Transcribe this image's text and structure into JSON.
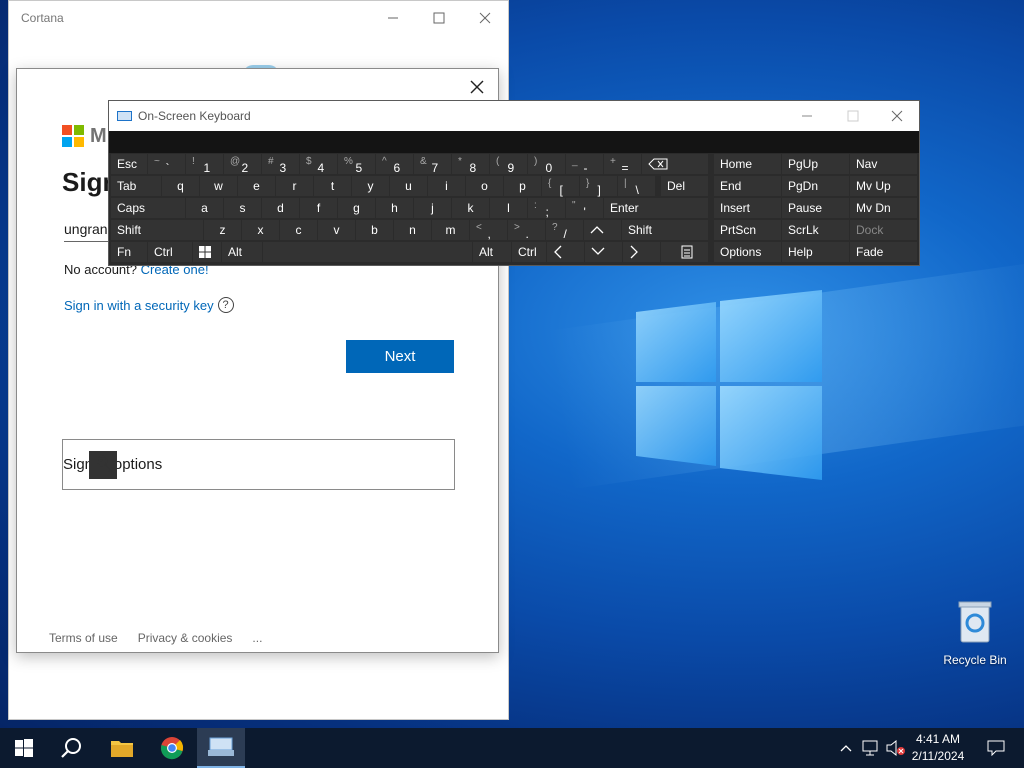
{
  "cortana": {
    "title": "Cortana"
  },
  "signin": {
    "brand": "M",
    "heading": "Sign",
    "email_value": "ungran",
    "no_account_text": "No account?",
    "create_link": "Create one!",
    "security_key_link": "Sign in with a security key",
    "help_glyph": "?",
    "next_label": "Next",
    "options_label": "Sign-in options",
    "footer": {
      "terms": "Terms of use",
      "privacy": "Privacy & cookies",
      "more": "..."
    }
  },
  "osk": {
    "title": "On-Screen Keyboard",
    "keys": {
      "esc": "Esc",
      "tab": "Tab",
      "caps": "Caps",
      "shift": "Shift",
      "fn": "Fn",
      "ctrl": "Ctrl",
      "alt": "Alt",
      "del": "Del",
      "enter": "Enter",
      "home": "Home",
      "pgup": "PgUp",
      "nav": "Nav",
      "end": "End",
      "pgdn": "PgDn",
      "mvup": "Mv Up",
      "insert": "Insert",
      "pause": "Pause",
      "mvdn": "Mv Dn",
      "prtscn": "PrtScn",
      "scrlk": "ScrLk",
      "dock": "Dock",
      "options": "Options",
      "help": "Help",
      "fade": "Fade"
    },
    "number_row": [
      {
        "s": "~",
        "m": "`"
      },
      {
        "s": "!",
        "m": "1"
      },
      {
        "s": "@",
        "m": "2"
      },
      {
        "s": "#",
        "m": "3"
      },
      {
        "s": "$",
        "m": "4"
      },
      {
        "s": "%",
        "m": "5"
      },
      {
        "s": "^",
        "m": "6"
      },
      {
        "s": "&",
        "m": "7"
      },
      {
        "s": "*",
        "m": "8"
      },
      {
        "s": "(",
        "m": "9"
      },
      {
        "s": ")",
        "m": "0"
      },
      {
        "s": "_",
        "m": "-"
      },
      {
        "s": "+",
        "m": "="
      }
    ],
    "row_q": [
      "q",
      "w",
      "e",
      "r",
      "t",
      "y",
      "u",
      "i",
      "o",
      "p"
    ],
    "row_q_sym": [
      {
        "s": "{",
        "m": "["
      },
      {
        "s": "}",
        "m": "]"
      },
      {
        "s": "|",
        "m": "\\"
      }
    ],
    "row_a": [
      "a",
      "s",
      "d",
      "f",
      "g",
      "h",
      "j",
      "k",
      "l"
    ],
    "row_a_sym": [
      {
        "s": ":",
        "m": ";"
      },
      {
        "s": "\"",
        "m": "'"
      }
    ],
    "row_z": [
      "z",
      "x",
      "c",
      "v",
      "b",
      "n",
      "m"
    ],
    "row_z_sym": [
      {
        "s": "<",
        "m": ","
      },
      {
        "s": ">",
        "m": "."
      },
      {
        "s": "?",
        "m": "/"
      }
    ]
  },
  "desktop": {
    "recycle_bin": "Recycle Bin"
  },
  "taskbar": {
    "time": "4:41 AM",
    "date": "2/11/2024"
  },
  "colors": {
    "accent": "#0067b8",
    "osk_bg": "#2b2b2b",
    "osk_key": "#333333",
    "taskbar": "#0c1a2f"
  }
}
